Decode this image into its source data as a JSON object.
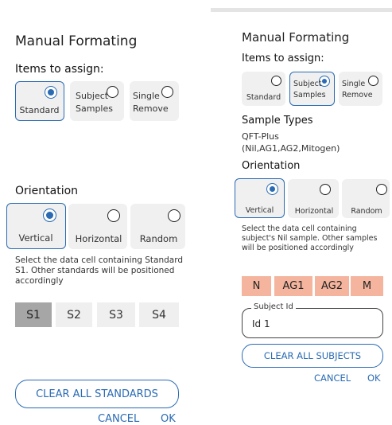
{
  "left": {
    "title": "Manual Formating",
    "items_heading": "Items to assign:",
    "items": [
      {
        "label_1": "Standard",
        "label_2": "",
        "selected": true
      },
      {
        "label_1": "Subject",
        "label_2": "Samples",
        "selected": false
      },
      {
        "label_1": "Single",
        "label_2": "Remove",
        "selected": false
      }
    ],
    "orientation_heading": "Orientation",
    "orientations": [
      {
        "label": "Vertical",
        "selected": true
      },
      {
        "label": "Horizontal",
        "selected": false
      },
      {
        "label": "Random",
        "selected": false
      }
    ],
    "instruction": "Select the data cell containing Standard S1. Other standards will be positioned accordingly",
    "standards": [
      {
        "label": "S1",
        "active": true
      },
      {
        "label": "S2",
        "active": false
      },
      {
        "label": "S3",
        "active": false
      },
      {
        "label": "S4",
        "active": false
      }
    ],
    "clear_button": "CLEAR ALL STANDARDS",
    "cancel": "CANCEL",
    "ok": "OK"
  },
  "right": {
    "title": "Manual Formating",
    "items_heading": "Items to assign:",
    "items": [
      {
        "label_1": "Standard",
        "label_2": "",
        "selected": false
      },
      {
        "label_1": "Subject",
        "label_2": "Samples",
        "selected": true
      },
      {
        "label_1": "Single",
        "label_2": "Remove",
        "selected": false
      }
    ],
    "sample_types_heading": "Sample Types",
    "sample_type_line1": "QFT-Plus",
    "sample_type_line2": "(Nil,AG1,AG2,Mitogen)",
    "orientation_heading": "Orientation",
    "orientations": [
      {
        "label": "Vertical",
        "selected": true
      },
      {
        "label": "Horizontal",
        "selected": false
      },
      {
        "label": "Random",
        "selected": false
      }
    ],
    "instruction": "Select the data cell containing subject's Nil sample. Other samples will be positioned accordingly",
    "samples": [
      "N",
      "AG1",
      "AG2",
      "M"
    ],
    "subject_id_label": "Subject Id",
    "subject_id_value": "Id 1",
    "clear_button": "CLEAR ALL SUBJECTS",
    "cancel": "CANCEL",
    "ok": "OK"
  },
  "colors": {
    "accent": "#2a6bb3",
    "option_bg": "#f0f0f0",
    "standard_active_bg": "#a6a6a6",
    "standard_bg": "#efefef",
    "sample_bg": "#f4b49e"
  }
}
